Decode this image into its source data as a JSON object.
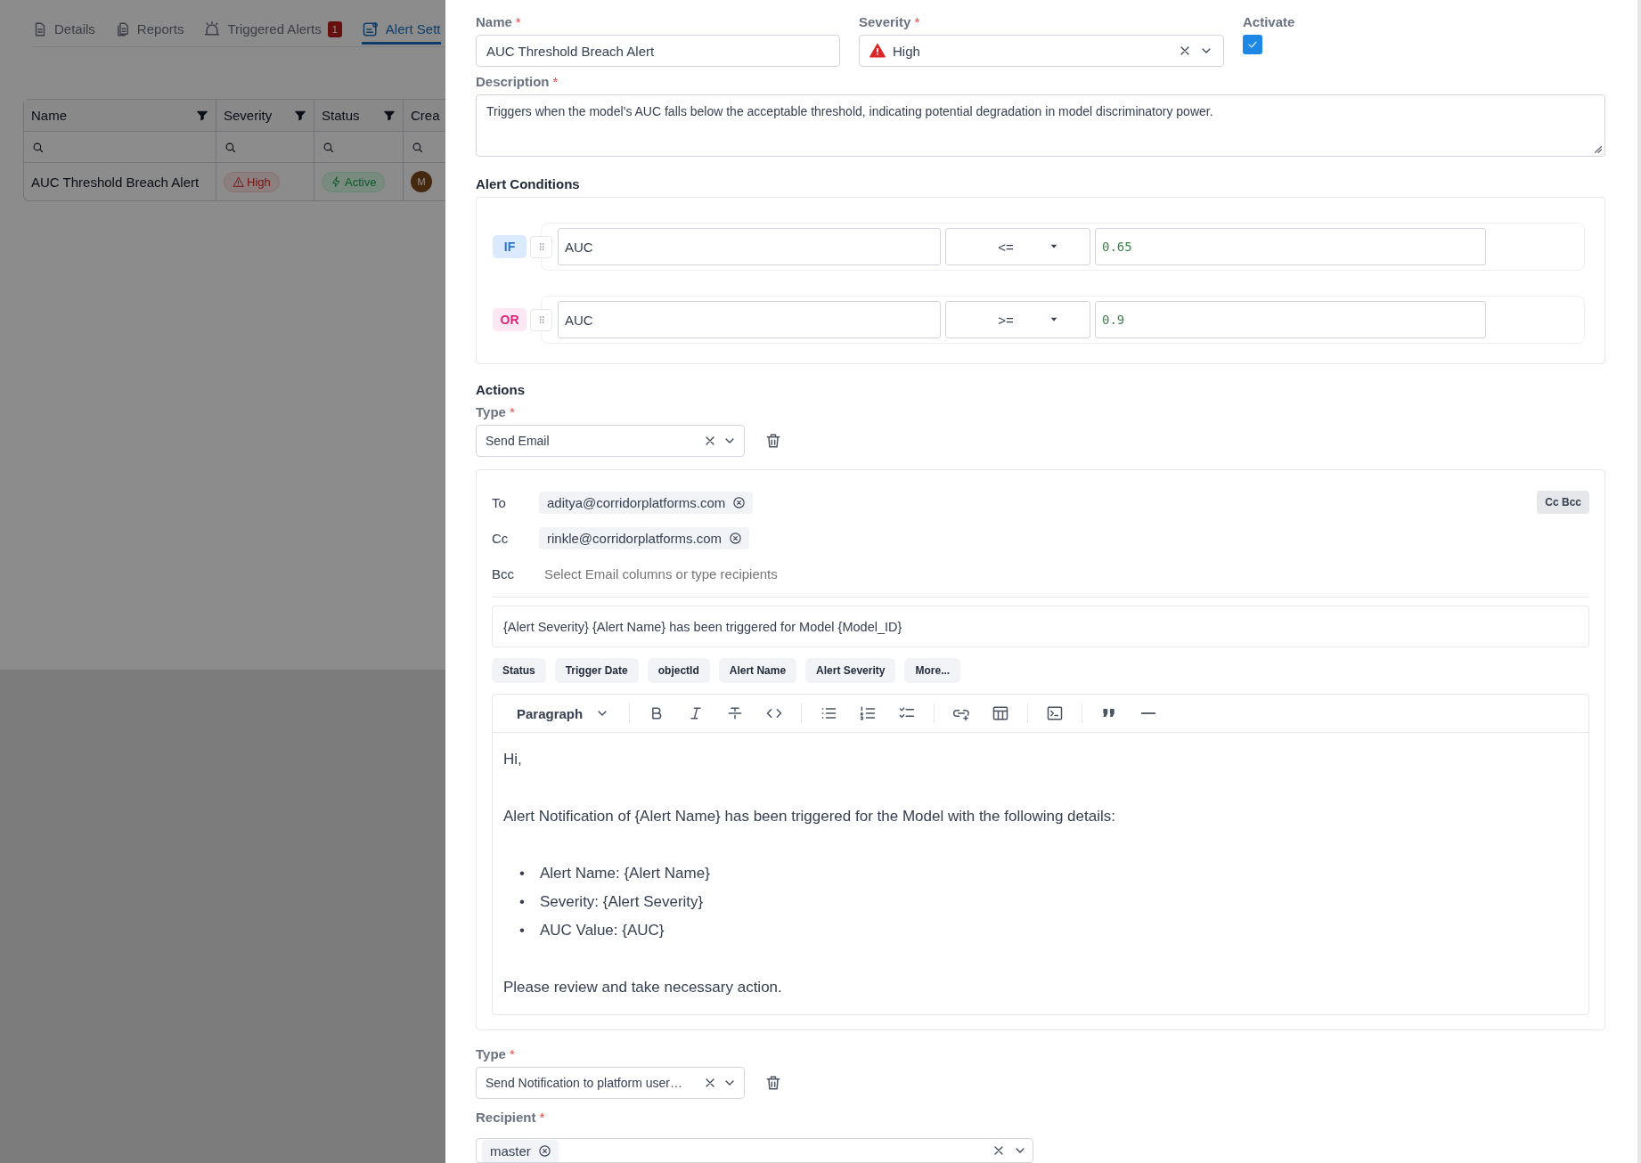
{
  "background": {
    "tabs": [
      {
        "label": "Details",
        "selected": false
      },
      {
        "label": "Reports",
        "selected": false
      },
      {
        "label": "Triggered Alerts",
        "badge": "1",
        "selected": false
      },
      {
        "label": "Alert Sett",
        "selected": true
      }
    ],
    "table": {
      "columns": [
        "Name",
        "Severity",
        "Status",
        "Crea"
      ],
      "rows": [
        {
          "name": "AUC Threshold Breach Alert",
          "severity": "High",
          "status": "Active",
          "avatar": "M"
        }
      ]
    }
  },
  "form": {
    "name": {
      "label": "Name",
      "required": "*",
      "value": "AUC Threshold Breach Alert"
    },
    "severity": {
      "label": "Severity",
      "required": "*",
      "value": "High"
    },
    "activate": {
      "label": "Activate",
      "checked": true
    },
    "description": {
      "label": "Description",
      "required": "*",
      "value": "Triggers when the model’s AUC falls below the acceptable threshold, indicating potential degradation in model discriminatory power."
    },
    "conditions": {
      "title": "Alert Conditions",
      "rows": [
        {
          "connector": "IF",
          "kind": "if",
          "field": "AUC",
          "operator": "<=",
          "value": "0.65"
        },
        {
          "connector": "OR",
          "kind": "or",
          "field": "AUC",
          "operator": ">=",
          "value": "0.9"
        }
      ]
    },
    "actions": {
      "title": "Actions",
      "items": [
        {
          "kind": "email",
          "type_label": "Type",
          "required": "*",
          "type": "Send Email",
          "to": {
            "label": "To",
            "chips": [
              "aditya@corridorplatforms.com"
            ]
          },
          "cc": {
            "label": "Cc",
            "chips": [
              "rinkle@corridorplatforms.com"
            ]
          },
          "bcc": {
            "label": "Bcc",
            "placeholder": "Select Email columns or type recipients"
          },
          "cc_bcc_button": "Cc Bcc",
          "subject": "{Alert Severity} {Alert Name} has been triggered for Model {Model_ID}",
          "variables": [
            "Status",
            "Trigger Date",
            "objectId",
            "Alert Name",
            "Alert Severity",
            "More..."
          ],
          "editor": {
            "block_style": "Paragraph",
            "body": [
              {
                "kind": "paragraph",
                "text": "Hi,"
              },
              {
                "kind": "paragraph",
                "text": "Alert Notification of {Alert Name} has been triggered for the Model with the following details:"
              },
              {
                "kind": "list",
                "marker": "•",
                "items": [
                  "Alert Name: {Alert Name}",
                  "Severity: {Alert Severity}",
                  "AUC Value: {AUC}"
                ]
              },
              {
                "kind": "paragraph",
                "text": "Please review and take necessary action."
              }
            ]
          }
        },
        {
          "kind": "notification",
          "type_label": "Type",
          "required": "*",
          "type": "Send Notification to platform user…",
          "recipient": {
            "label": "Recipient",
            "required": "*",
            "chips": [
              "master"
            ]
          }
        }
      ]
    }
  }
}
